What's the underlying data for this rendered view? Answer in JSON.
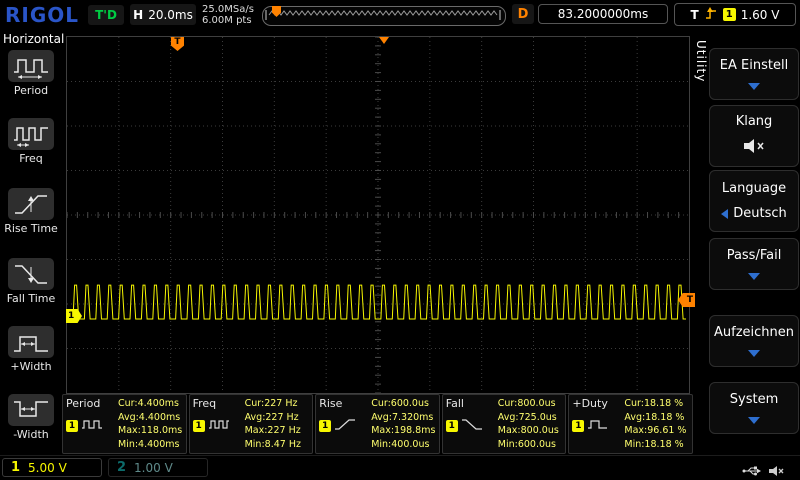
{
  "brand": "RIGOL",
  "top_bar": {
    "status": "T'D",
    "horizontal": {
      "label": "H",
      "value": "20.0ms"
    },
    "acquisition": {
      "sample_rate": "25.0MSa/s",
      "memory_depth": "6.00M pts"
    },
    "delay": {
      "label": "D",
      "value": "83.2000000ms"
    },
    "trigger": {
      "label": "T",
      "channel": "1",
      "level": "1.60 V"
    }
  },
  "left_menu": {
    "title": "Horizontal",
    "items": [
      {
        "label": "Period"
      },
      {
        "label": "Freq"
      },
      {
        "label": "Rise Time"
      },
      {
        "label": "Fall Time"
      },
      {
        "label": "+Width"
      },
      {
        "label": "-Width"
      }
    ]
  },
  "grid": {
    "trigger_flag_label": "T",
    "trigger_level_label": "T",
    "channel_marker_label": "1"
  },
  "measurements": [
    {
      "name": "Period",
      "channel": "1",
      "cur": "Cur:4.400ms",
      "avg": "Avg:4.400ms",
      "max": "Max:118.0ms",
      "min": "Min:4.400ms"
    },
    {
      "name": "Freq",
      "channel": "1",
      "cur": "Cur:227 Hz",
      "avg": "Avg:227 Hz",
      "max": "Max:227 Hz",
      "min": "Min:8.47 Hz"
    },
    {
      "name": "Rise",
      "channel": "1",
      "cur": "Cur:600.0us",
      "avg": "Avg:7.320ms",
      "max": "Max:198.8ms",
      "min": "Min:400.0us"
    },
    {
      "name": "Fall",
      "channel": "1",
      "cur": "Cur:800.0us",
      "avg": "Avg:725.0us",
      "max": "Max:800.0us",
      "min": "Min:600.0us"
    },
    {
      "name": "+Duty",
      "channel": "1",
      "cur": "Cur:18.18 %",
      "avg": "Avg:18.18 %",
      "max": "Max:96.61 %",
      "min": "Min:18.18 %"
    }
  ],
  "right_menu": {
    "tab": "Utility",
    "buttons": [
      {
        "label": "EA Einstell"
      },
      {
        "label": "Klang"
      },
      {
        "label": "Language",
        "value": "Deutsch"
      },
      {
        "label": "Pass/Fail"
      },
      {
        "label": "Aufzeichnen"
      },
      {
        "label": "System"
      }
    ]
  },
  "channel_bar": {
    "ch1": {
      "id": "1",
      "scale": "5.00 V",
      "color": "#f7f700"
    },
    "ch2": {
      "id": "2",
      "scale": "1.00 V",
      "color": "#0d6b6b"
    }
  },
  "waveform": {
    "type": "pulse_train",
    "channel": 1,
    "color": "#f7f700",
    "timebase_ms_per_div": 20,
    "h_divs": 12,
    "v_divs": 8,
    "period_ms": 4.4,
    "high_ms": 0.8,
    "rise_ms": 0.6,
    "fall_ms": 0.8,
    "baseline_frac": 0.792,
    "top_frac": 0.697
  }
}
